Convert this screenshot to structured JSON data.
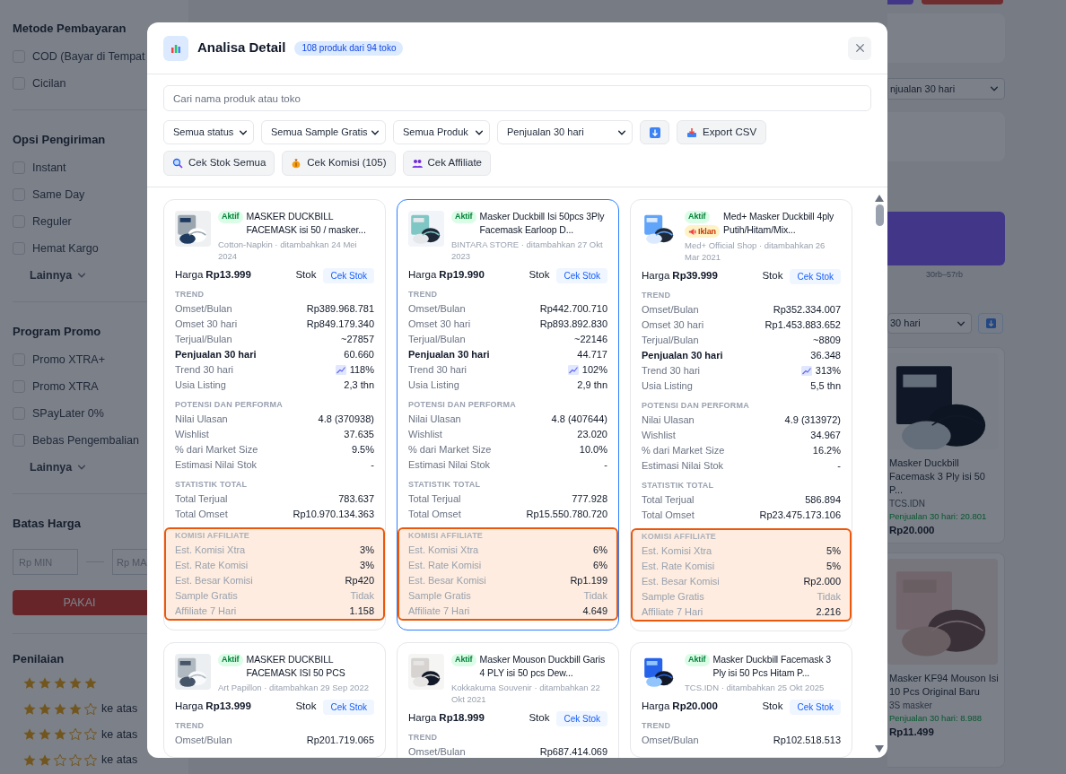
{
  "sidebar": {
    "sections": [
      {
        "title": "Metode Pembayaran",
        "options": [
          {
            "label": "COD (Bayar di Tempat",
            "checked": false
          },
          {
            "label": "Cicilan",
            "checked": false
          }
        ]
      },
      {
        "title": "Opsi Pengiriman",
        "options": [
          {
            "label": "Instant",
            "checked": false
          },
          {
            "label": "Same Day",
            "checked": false
          },
          {
            "label": "Reguler",
            "checked": false
          },
          {
            "label": "Hemat Kargo",
            "checked": false
          }
        ],
        "more": "Lainnya"
      },
      {
        "title": "Program Promo",
        "options": [
          {
            "label": "Promo XTRA+",
            "checked": false
          },
          {
            "label": "Promo XTRA",
            "checked": false
          },
          {
            "label": "SPayLater 0%",
            "checked": false
          },
          {
            "label": "Bebas Pengembalian",
            "checked": false
          }
        ],
        "more": "Lainnya"
      }
    ],
    "price_filter": {
      "title": "Batas Harga",
      "min_placeholder": "Rp MIN",
      "max_placeholder": "Rp MA",
      "apply": "PAKAI"
    },
    "rating": {
      "title": "Penilaian",
      "rows": [
        {
          "stars": 5
        },
        {
          "stars": 4,
          "label": "ke atas"
        },
        {
          "stars": 3,
          "label": "ke atas"
        },
        {
          "stars": 2,
          "label": "ke atas"
        }
      ]
    }
  },
  "right_strip": {
    "sort_select": "njualan 30 hari",
    "price_range": "30rb–57rb",
    "period_select": "30 hari",
    "products": [
      {
        "title": "Masker Duckbill Facemask 3 Ply isi 50 P...",
        "shop": "TCS.IDN",
        "sales": "Penjualan 30 hari: 20.801",
        "price": "Rp20.000"
      },
      {
        "title": "Masker KF94 Mouson Isi 10 Pcs Original Baru",
        "shop": "3S masker",
        "sales": "Penjualan 30 hari: 8.988",
        "price": "Rp11.499"
      }
    ]
  },
  "modal": {
    "title": "Analisa Detail",
    "count_badge": "108 produk dari 94 toko",
    "search_placeholder": "Cari nama produk atau toko",
    "filters": [
      "Semua status",
      "Semua Sample Gratis",
      "Semua Produk",
      "Penjualan 30 hari"
    ],
    "export": "Export CSV",
    "actions": [
      "Cek Stok Semua",
      "Cek Komisi (105)",
      "Cek Affiliate"
    ],
    "cards": [
      {
        "selected": false,
        "badges": [
          {
            "label": "Aktif",
            "kind": "active"
          }
        ],
        "title": "MASKER DUCKBILL FACEMASK isi 50 / masker...",
        "meta": "Cotton-Napkin · ditambahkan 24 Mei 2024",
        "price_label": "Harga",
        "price": "Rp13.999",
        "stock_label": "Stok",
        "stock_button": "Cek Stok",
        "sections": [
          {
            "title": "TREND",
            "highlighted": false,
            "rows": [
              {
                "label": "Omset/Bulan",
                "value": "Rp389.968.781",
                "kind": "plain"
              },
              {
                "label": "Omset 30 hari",
                "value": "Rp849.179.340",
                "kind": "plain"
              },
              {
                "label": "Terjual/Bulan",
                "value": "~27857",
                "kind": "plain"
              },
              {
                "label": "Penjualan 30 hari",
                "value": "60.660",
                "kind": "bold"
              },
              {
                "label": "Trend 30 hari",
                "value": "118%",
                "kind": "trend"
              },
              {
                "label": "Usia Listing",
                "value": "2,3 thn",
                "kind": "plain"
              }
            ]
          },
          {
            "title": "POTENSI DAN PERFORMA",
            "highlighted": false,
            "rows": [
              {
                "label": "Nilai Ulasan",
                "value": "4.8 (370938)",
                "kind": "plain"
              },
              {
                "label": "Wishlist",
                "value": "37.635",
                "kind": "plain"
              },
              {
                "label": "% dari Market Size",
                "value": "9.5%",
                "kind": "plain"
              },
              {
                "label": "Estimasi Nilai Stok",
                "value": "-",
                "kind": "plain"
              }
            ]
          },
          {
            "title": "STATISTIK TOTAL",
            "highlighted": false,
            "rows": [
              {
                "label": "Total Terjual",
                "value": "783.637",
                "kind": "plain"
              },
              {
                "label": "Total Omset",
                "value": "Rp10.970.134.363",
                "kind": "plain"
              }
            ]
          },
          {
            "title": "KOMISI AFFILIATE",
            "highlighted": true,
            "rows": [
              {
                "label": "Est. Komisi Xtra",
                "value": "3%",
                "kind": "plain"
              },
              {
                "label": "Est. Rate Komisi",
                "value": "3%",
                "kind": "plain"
              },
              {
                "label": "Est. Besar Komisi",
                "value": "Rp420",
                "kind": "plain"
              },
              {
                "label": "Sample Gratis",
                "value": "Tidak",
                "kind": "muted"
              },
              {
                "label": "Affiliate 7 Hari",
                "value": "1.158",
                "kind": "plain"
              }
            ]
          }
        ]
      },
      {
        "selected": true,
        "badges": [
          {
            "label": "Aktif",
            "kind": "active"
          }
        ],
        "title": "Masker Duckbill Isi 50pcs 3Ply Facemask Earloop D...",
        "meta": "BINTARA STORE · ditambahkan 27 Okt 2023",
        "price_label": "Harga",
        "price": "Rp19.990",
        "stock_label": "Stok",
        "stock_button": "Cek Stok",
        "sections": [
          {
            "title": "TREND",
            "highlighted": false,
            "rows": [
              {
                "label": "Omset/Bulan",
                "value": "Rp442.700.710",
                "kind": "plain"
              },
              {
                "label": "Omset 30 hari",
                "value": "Rp893.892.830",
                "kind": "plain"
              },
              {
                "label": "Terjual/Bulan",
                "value": "~22146",
                "kind": "plain"
              },
              {
                "label": "Penjualan 30 hari",
                "value": "44.717",
                "kind": "bold"
              },
              {
                "label": "Trend 30 hari",
                "value": "102%",
                "kind": "trend"
              },
              {
                "label": "Usia Listing",
                "value": "2,9 thn",
                "kind": "plain"
              }
            ]
          },
          {
            "title": "POTENSI DAN PERFORMA",
            "highlighted": false,
            "rows": [
              {
                "label": "Nilai Ulasan",
                "value": "4.8 (407644)",
                "kind": "plain"
              },
              {
                "label": "Wishlist",
                "value": "23.020",
                "kind": "plain"
              },
              {
                "label": "% dari Market Size",
                "value": "10.0%",
                "kind": "plain"
              },
              {
                "label": "Estimasi Nilai Stok",
                "value": "-",
                "kind": "plain"
              }
            ]
          },
          {
            "title": "STATISTIK TOTAL",
            "highlighted": false,
            "rows": [
              {
                "label": "Total Terjual",
                "value": "777.928",
                "kind": "plain"
              },
              {
                "label": "Total Omset",
                "value": "Rp15.550.780.720",
                "kind": "plain"
              }
            ]
          },
          {
            "title": "KOMISI AFFILIATE",
            "highlighted": true,
            "rows": [
              {
                "label": "Est. Komisi Xtra",
                "value": "6%",
                "kind": "plain"
              },
              {
                "label": "Est. Rate Komisi",
                "value": "6%",
                "kind": "plain"
              },
              {
                "label": "Est. Besar Komisi",
                "value": "Rp1.199",
                "kind": "plain"
              },
              {
                "label": "Sample Gratis",
                "value": "Tidak",
                "kind": "muted"
              },
              {
                "label": "Affiliate 7 Hari",
                "value": "4.649",
                "kind": "plain"
              }
            ]
          }
        ]
      },
      {
        "selected": false,
        "badges": [
          {
            "label": "Aktif",
            "kind": "active"
          },
          {
            "label": "Iklan",
            "kind": "ad"
          }
        ],
        "title": "Med+ Masker Duckbill 4ply Putih/Hitam/Mix...",
        "meta": "Med+ Official Shop · ditambahkan 26 Mar 2021",
        "price_label": "Harga",
        "price": "Rp39.999",
        "stock_label": "Stok",
        "stock_button": "Cek Stok",
        "sections": [
          {
            "title": "TREND",
            "highlighted": false,
            "rows": [
              {
                "label": "Omset/Bulan",
                "value": "Rp352.334.007",
                "kind": "plain"
              },
              {
                "label": "Omset 30 hari",
                "value": "Rp1.453.883.652",
                "kind": "plain"
              },
              {
                "label": "Terjual/Bulan",
                "value": "~8809",
                "kind": "plain"
              },
              {
                "label": "Penjualan 30 hari",
                "value": "36.348",
                "kind": "bold"
              },
              {
                "label": "Trend 30 hari",
                "value": "313%",
                "kind": "trend"
              },
              {
                "label": "Usia Listing",
                "value": "5,5 thn",
                "kind": "plain"
              }
            ]
          },
          {
            "title": "POTENSI DAN PERFORMA",
            "highlighted": false,
            "rows": [
              {
                "label": "Nilai Ulasan",
                "value": "4.9 (313972)",
                "kind": "plain"
              },
              {
                "label": "Wishlist",
                "value": "34.967",
                "kind": "plain"
              },
              {
                "label": "% dari Market Size",
                "value": "16.2%",
                "kind": "plain"
              },
              {
                "label": "Estimasi Nilai Stok",
                "value": "-",
                "kind": "plain"
              }
            ]
          },
          {
            "title": "STATISTIK TOTAL",
            "highlighted": false,
            "rows": [
              {
                "label": "Total Terjual",
                "value": "586.894",
                "kind": "plain"
              },
              {
                "label": "Total Omset",
                "value": "Rp23.475.173.106",
                "kind": "plain"
              }
            ]
          },
          {
            "title": "KOMISI AFFILIATE",
            "highlighted": true,
            "rows": [
              {
                "label": "Est. Komisi Xtra",
                "value": "5%",
                "kind": "plain"
              },
              {
                "label": "Est. Rate Komisi",
                "value": "5%",
                "kind": "plain"
              },
              {
                "label": "Est. Besar Komisi",
                "value": "Rp2.000",
                "kind": "plain"
              },
              {
                "label": "Sample Gratis",
                "value": "Tidak",
                "kind": "muted"
              },
              {
                "label": "Affiliate 7 Hari",
                "value": "2.216",
                "kind": "plain"
              }
            ]
          }
        ]
      },
      {
        "selected": false,
        "badges": [
          {
            "label": "Aktif",
            "kind": "active"
          }
        ],
        "title": "MASKER DUCKBILL FACEMASK ISI 50 PCS",
        "meta": "Art Papillon · ditambahkan 29 Sep 2022",
        "price_label": "Harga",
        "price": "Rp13.999",
        "stock_label": "Stok",
        "stock_button": "Cek Stok",
        "sections": [
          {
            "title": "TREND",
            "highlighted": false,
            "rows": [
              {
                "label": "Omset/Bulan",
                "value": "Rp201.719.065",
                "kind": "plain"
              }
            ]
          }
        ]
      },
      {
        "selected": false,
        "badges": [
          {
            "label": "Aktif",
            "kind": "active"
          }
        ],
        "title": "Masker Mouson Duckbill Garis 4 PLY isi 50 pcs Dew...",
        "meta": "Kokkakuma Souvenir · ditambahkan 22 Okt 2021",
        "price_label": "Harga",
        "price": "Rp18.999",
        "stock_label": "Stok",
        "stock_button": "Cek Stok",
        "sections": [
          {
            "title": "TREND",
            "highlighted": false,
            "rows": [
              {
                "label": "Omset/Bulan",
                "value": "Rp687.414.069",
                "kind": "plain"
              }
            ]
          }
        ]
      },
      {
        "selected": false,
        "badges": [
          {
            "label": "Aktif",
            "kind": "active"
          }
        ],
        "title": "Masker Duckbill Facemask 3 Ply isi 50 Pcs Hitam P...",
        "meta": "TCS.IDN · ditambahkan 25 Okt 2025",
        "price_label": "Harga",
        "price": "Rp20.000",
        "stock_label": "Stok",
        "stock_button": "Cek Stok",
        "sections": [
          {
            "title": "TREND",
            "highlighted": false,
            "rows": [
              {
                "label": "Omset/Bulan",
                "value": "Rp102.518.513",
                "kind": "plain"
              }
            ]
          }
        ]
      }
    ]
  }
}
